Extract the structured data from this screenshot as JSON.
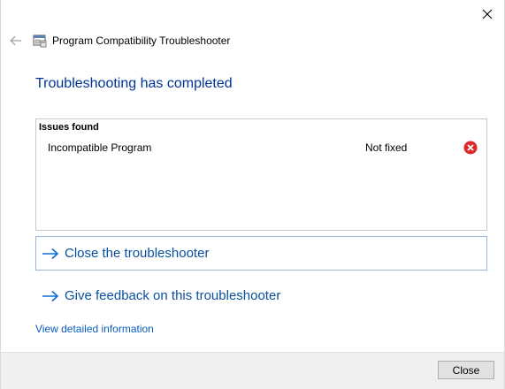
{
  "window": {
    "title": "Program Compatibility Troubleshooter",
    "close_icon": "close-icon",
    "back_icon": "back-arrow-icon",
    "app_icon": "troubleshooter-app-icon"
  },
  "main": {
    "heading": "Troubleshooting has completed",
    "issues": {
      "header": "Issues found",
      "rows": [
        {
          "name": "Incompatible Program",
          "status": "Not fixed",
          "status_icon": "error-icon"
        }
      ]
    },
    "actions": [
      {
        "label": "Close the troubleshooter",
        "icon": "arrow-right-icon"
      },
      {
        "label": "Give feedback on this troubleshooter",
        "icon": "arrow-right-icon"
      }
    ],
    "detail_link": "View detailed information"
  },
  "footer": {
    "close_label": "Close"
  },
  "colors": {
    "heading": "#003399",
    "link": "#0a4fa0",
    "error": "#d92b2b",
    "focus_border": "#9ab8d8",
    "footer_bg": "#f0f0f0"
  }
}
